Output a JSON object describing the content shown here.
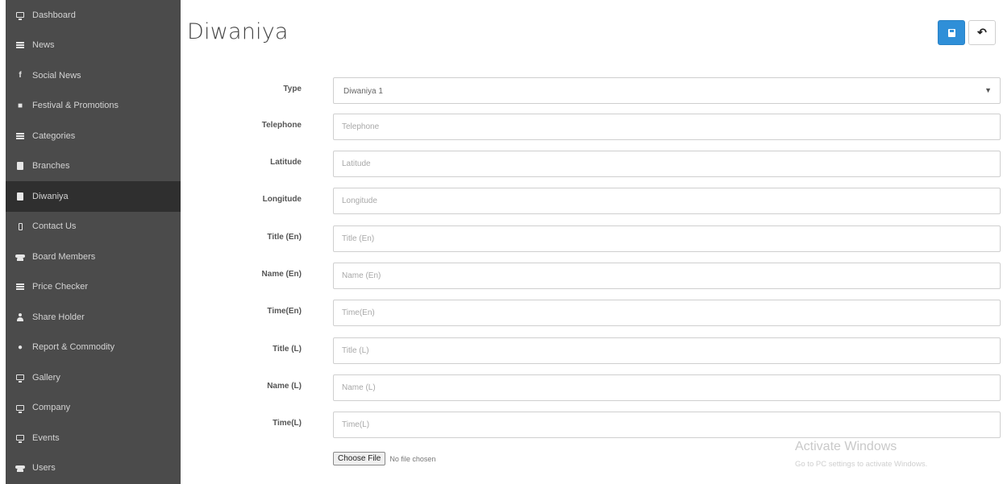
{
  "sidebar": {
    "items": [
      {
        "label": "Dashboard",
        "icon": "monitor-icon"
      },
      {
        "label": "News",
        "icon": "list-icon"
      },
      {
        "label": "Social News",
        "icon": "facebook-icon"
      },
      {
        "label": "Festival & Promotions",
        "icon": "gift-icon"
      },
      {
        "label": "Categories",
        "icon": "table-icon"
      },
      {
        "label": "Branches",
        "icon": "book-icon"
      },
      {
        "label": "Diwaniya",
        "icon": "book-icon",
        "active": true
      },
      {
        "label": "Contact Us",
        "icon": "phone-icon"
      },
      {
        "label": "Board Members",
        "icon": "users-icon"
      },
      {
        "label": "Price Checker",
        "icon": "list-icon"
      },
      {
        "label": "Share Holder",
        "icon": "user-icon"
      },
      {
        "label": "Report & Commodity",
        "icon": "comments-icon"
      },
      {
        "label": "Gallery",
        "icon": "monitor-icon"
      },
      {
        "label": "Company",
        "icon": "monitor-icon"
      },
      {
        "label": "Events",
        "icon": "monitor-icon"
      },
      {
        "label": "Users",
        "icon": "users-icon"
      }
    ]
  },
  "header": {
    "title": "Diwaniya",
    "save_icon": "save-icon",
    "back_icon": "reply-icon",
    "accent_color": "#2f8fd8"
  },
  "form": {
    "type": {
      "label": "Type",
      "value": "Diwaniya 1"
    },
    "fields": [
      {
        "label": "Telephone",
        "placeholder": "Telephone"
      },
      {
        "label": "Latitude",
        "placeholder": "Latitude"
      },
      {
        "label": "Longitude",
        "placeholder": "Longitude"
      },
      {
        "label": "Title (En)",
        "placeholder": "Title (En)"
      },
      {
        "label": "Name (En)",
        "placeholder": "Name (En)"
      },
      {
        "label": "Time(En)",
        "placeholder": "Time(En)"
      },
      {
        "label": "Title (L)",
        "placeholder": "Title (L)"
      },
      {
        "label": "Name (L)",
        "placeholder": "Name (L)"
      },
      {
        "label": "Time(L)",
        "placeholder": "Time(L)"
      }
    ],
    "file": {
      "button_label": "Choose File",
      "status": "No file chosen"
    }
  },
  "watermark": {
    "title": "Activate Windows",
    "subtitle": "Go to PC settings to activate Windows."
  }
}
